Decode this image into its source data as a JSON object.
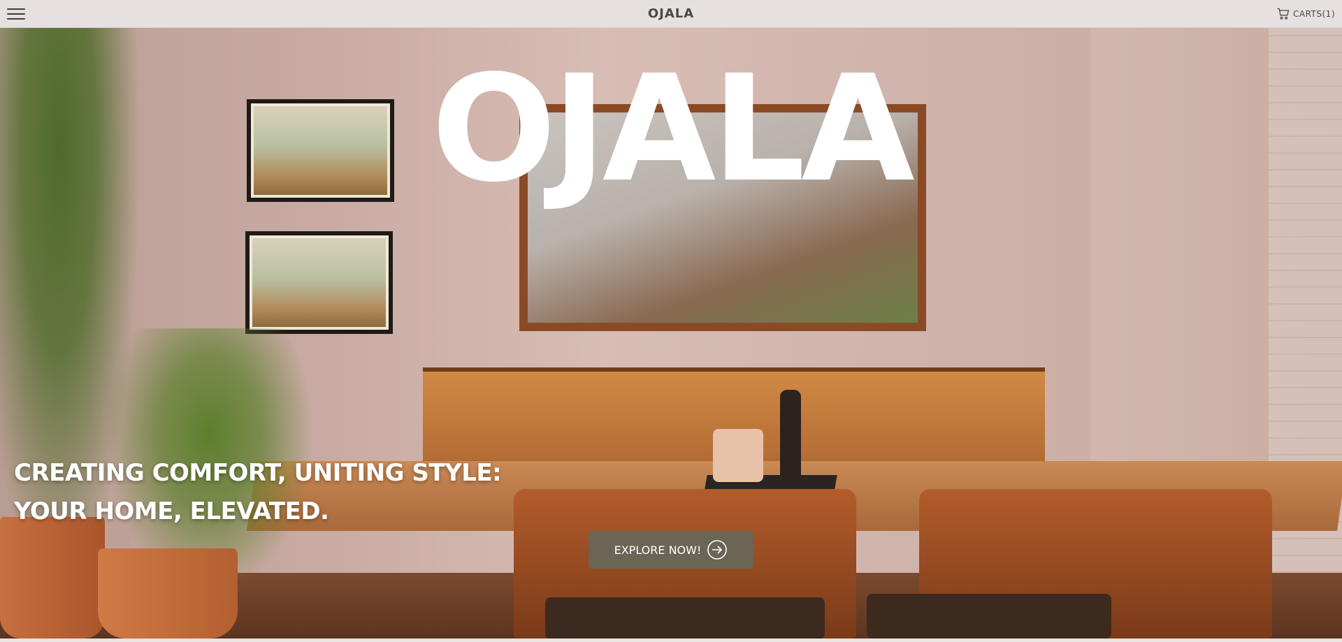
{
  "header": {
    "menu_icon": "hamburger-menu-icon",
    "brand": "OJALA",
    "cart_icon": "shopping-cart-icon",
    "cart_label": "CARTS(1)"
  },
  "hero": {
    "title": "OJALA",
    "tagline_line1": "CREATING COMFORT, UNITING STYLE:",
    "tagline_line2": "YOUR HOME, ELEVATED.",
    "cta_label": "EXPLORE NOW!",
    "cta_icon": "arrow-right-circle-icon"
  },
  "colors": {
    "topbar_bg": "#e6e1e0",
    "brand_text": "#4a4744",
    "cta_bg": "#6a6554",
    "hero_text": "#ffffff"
  }
}
